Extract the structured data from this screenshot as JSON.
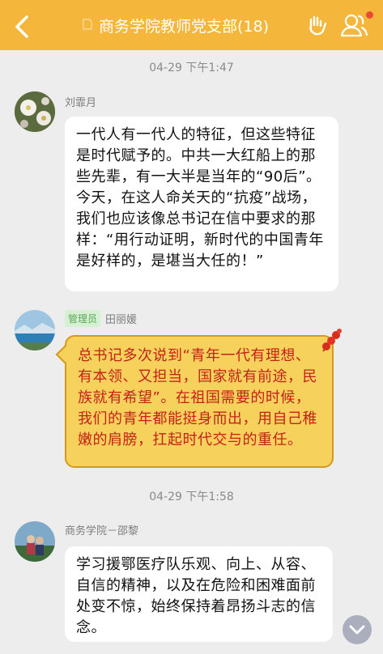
{
  "header": {
    "title": "商务学院教师党支部(18)",
    "back_icon": "chevron-left-icon",
    "hand_icon": "hand-gesture-icon",
    "members_icon": "group-members-icon",
    "bg_color": "#F5B73B",
    "notification_dot": true
  },
  "messages": [
    {
      "timestamp": "04-29 下午1:47",
      "sender": "刘霏月",
      "text": "一代人有一代人的特征，但这些特征是时代赋予的。中共一大红船上的那些先辈，有一大半是当年的“90后”。今天，在这人命关天的“抗疫”战场，我们也应该像总书记在信中要求的那样：“用行动证明，新时代的中国青年是好样的，是堪当大任的！”"
    },
    {
      "badge": "管理员",
      "sender": "田丽媛",
      "text": "总书记多次说到“青年一代有理想、有本领、又担当，国家就有前途，民族就有希望”。在祖国需要的时候，我们的青年都能挺身而出，用自己稚嫩的肩膀，扛起时代交与的重任。"
    },
    {
      "timestamp": "04-29 下午1:58",
      "sender": "商务学院－邵黎",
      "text": "学习援鄂医疗队乐观、向上、从容、自信的精神，以及在危险和困难面前处变不惊，始终保持着昂扬斗志的信念。"
    }
  ]
}
